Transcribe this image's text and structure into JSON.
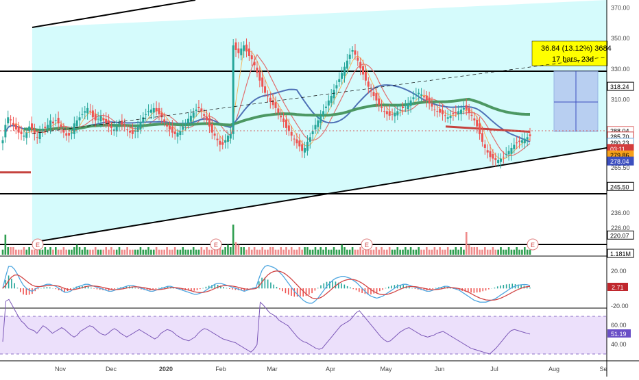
{
  "chart_data": {
    "type": "candlestick",
    "x_ticks": [
      "Nov",
      "Dec",
      "2020",
      "Feb",
      "Mar",
      "Apr",
      "May",
      "Jun",
      "Jul",
      "Aug",
      "Se"
    ],
    "price_axis": {
      "range": [
        218,
        372
      ],
      "tick_labels": [
        {
          "v": 370,
          "t": "370.00"
        },
        {
          "v": 350,
          "t": "350.00"
        },
        {
          "v": 330,
          "t": "330.00"
        },
        {
          "v": 310,
          "t": "310.00"
        },
        {
          "v": 265.5,
          "t": "265.50"
        },
        {
          "v": 236,
          "t": "236.00"
        },
        {
          "v": 226,
          "t": "226.00"
        }
      ]
    },
    "price_labels": [
      {
        "v": 318.24,
        "t": "318.24",
        "fill": "#ffffff",
        "stroke": "#000000",
        "color": "#000000"
      },
      {
        "v": 289.3,
        "t": "288.04",
        "fill": "#ffffff",
        "stroke": "#e07070",
        "color": "#000000"
      },
      {
        "v": 285.7,
        "t": "285.70",
        "fill": "#ffffff",
        "stroke": "#cc3333",
        "color": "#000000"
      },
      {
        "v": 281.6,
        "t": "280.23",
        "fill": "#ffffff",
        "stroke": "#6fa8dc",
        "color": "#000000"
      },
      {
        "v": 277.6,
        "t": "03:11",
        "fill": "#d33d3d",
        "stroke": "#d33d3d",
        "color": "#ffffff"
      },
      {
        "v": 273.4,
        "t": "279.86",
        "fill": "#f7a11a",
        "stroke": "#f7a11a",
        "color": "#000000"
      },
      {
        "v": 269.4,
        "t": "278.04",
        "fill": "#3d4fbf",
        "stroke": "#3d4fbf",
        "color": "#ffffff"
      },
      {
        "v": 252.8,
        "t": "245.50",
        "fill": "#ffffff",
        "stroke": "#000000",
        "color": "#000000"
      },
      {
        "v": 221.0,
        "t": "220.07",
        "fill": "#ffffff",
        "stroke": "#000000",
        "color": "#000000"
      }
    ],
    "volume_label": "1.181M",
    "hlines": [
      318.24,
      245.5,
      220.07
    ],
    "measure_label": {
      "line1": "36.84 (13.12%) 3684",
      "line2": "17 bars, 23d"
    },
    "earnings_marker": "E",
    "price_series_close": [
      283,
      293,
      298,
      296,
      293,
      290,
      288,
      287,
      286,
      288,
      292,
      290,
      287,
      285,
      288,
      290,
      291,
      293,
      296,
      294,
      296,
      294,
      292,
      288,
      286,
      286,
      288,
      294,
      296,
      298,
      300,
      302,
      304,
      302,
      298,
      296,
      297,
      299,
      296,
      294,
      292,
      291,
      290,
      292,
      294,
      293,
      292,
      290,
      288,
      287,
      289,
      292,
      295,
      298,
      300,
      302,
      303,
      304,
      302,
      300,
      298,
      295,
      292,
      290,
      288,
      287,
      288,
      289,
      292,
      294,
      297,
      299,
      301,
      303,
      304,
      302,
      299,
      296,
      292,
      288,
      286,
      283,
      280,
      280,
      283,
      286,
      287,
      345,
      342,
      340,
      343,
      345,
      341,
      338,
      336,
      332,
      327,
      322,
      318,
      314,
      312,
      308,
      306,
      304,
      301,
      298,
      295,
      291,
      289,
      286,
      284,
      281,
      279,
      276,
      278,
      282,
      285,
      289,
      293,
      296,
      299,
      302,
      305,
      309,
      312,
      316,
      319,
      323,
      327,
      331,
      335,
      339,
      342,
      339,
      335,
      330,
      326,
      322,
      318,
      315,
      312,
      309,
      306,
      304,
      302,
      300,
      299,
      300,
      301,
      302,
      303,
      304,
      305,
      307,
      309,
      311,
      313,
      314,
      313,
      311,
      309,
      307,
      305,
      303,
      302,
      301,
      300,
      299,
      298,
      299,
      300,
      301,
      302,
      303,
      304,
      303,
      301,
      299,
      296,
      292,
      287,
      282,
      278,
      275,
      272,
      271,
      270,
      270,
      271,
      272,
      274,
      276,
      278,
      280,
      281,
      282,
      283,
      284,
      285,
      285.7
    ],
    "volume_series": [
      2,
      8,
      3,
      3,
      3,
      2,
      2,
      2,
      3,
      2,
      3,
      2,
      2,
      3,
      2,
      2,
      3,
      2,
      3,
      2,
      3,
      2,
      2,
      3,
      2,
      2,
      2,
      3,
      4,
      3,
      2,
      3,
      2,
      2,
      2,
      3,
      2,
      2,
      2,
      3,
      2,
      3,
      2,
      2,
      3,
      2,
      2,
      3,
      2,
      2,
      2,
      2,
      3,
      2,
      2,
      3,
      2,
      2,
      3,
      2,
      2,
      2,
      3,
      2,
      2,
      3,
      2,
      2,
      3,
      2,
      2,
      2,
      3,
      2,
      2,
      3,
      2,
      3,
      2,
      2,
      2,
      3,
      3,
      2,
      3,
      4,
      3,
      12,
      5,
      4,
      3,
      3,
      2,
      3,
      2,
      3,
      2,
      2,
      3,
      2,
      2,
      3,
      3,
      2,
      2,
      3,
      2,
      3,
      2,
      3,
      2,
      2,
      3,
      2,
      3,
      3,
      2,
      2,
      3,
      2,
      3,
      2,
      3,
      2,
      2,
      3,
      2,
      2,
      4,
      3,
      2,
      2,
      3,
      2,
      2,
      3,
      2,
      2,
      3,
      2,
      2,
      3,
      2,
      3,
      2,
      2,
      3,
      2,
      2,
      3,
      2,
      2,
      3,
      2,
      3,
      2,
      2,
      3,
      2,
      2,
      3,
      2,
      2,
      3,
      2,
      3,
      2,
      2,
      3,
      2,
      2,
      3,
      2,
      3,
      2,
      9,
      4,
      3,
      3,
      3,
      2,
      2,
      3,
      2,
      2,
      3,
      2,
      2,
      3,
      2,
      2,
      3,
      2,
      2,
      3,
      2,
      2,
      3,
      2,
      2
    ],
    "macd_series": [
      0,
      12,
      22,
      22,
      19,
      14,
      8,
      3,
      0,
      -2,
      -3,
      -1,
      1,
      2,
      3,
      4,
      4,
      3,
      2,
      0,
      -2,
      -4,
      -4,
      -3,
      -1,
      1,
      2,
      3,
      4,
      4,
      3,
      2,
      1,
      0,
      -1,
      -2,
      -3,
      -3,
      -2,
      -1,
      0,
      1,
      2,
      3,
      3,
      2,
      1,
      0,
      -1,
      -2,
      -3,
      -3,
      -2,
      -1,
      0,
      1,
      2,
      2,
      1,
      0,
      -1,
      -2,
      -3,
      -4,
      -5,
      -6,
      -6,
      -5,
      -4,
      -2,
      0,
      2,
      4,
      5,
      5,
      4,
      3,
      2,
      1,
      0,
      -1,
      -2,
      -3,
      -2,
      -1,
      0,
      1,
      10,
      18,
      22,
      23,
      22,
      21,
      19,
      16,
      13,
      9,
      5,
      1,
      -3,
      -6,
      -9,
      -12,
      -14,
      -15,
      -15,
      -13,
      -10,
      -6,
      -2,
      2,
      5,
      8,
      10,
      11,
      12,
      12,
      11,
      10,
      8,
      6,
      3,
      0,
      -3,
      -6,
      -8,
      -9,
      -10,
      -9,
      -8,
      -6,
      -4,
      -2,
      0,
      2,
      3,
      4,
      4,
      3,
      2,
      1,
      0,
      -1,
      -2,
      -3,
      -3,
      -2,
      -1,
      0,
      1,
      2,
      2,
      1,
      0,
      -1,
      -2,
      -4,
      -6,
      -8,
      -10,
      -12,
      -13,
      -14,
      -14,
      -14,
      -13,
      -12,
      -11,
      -9,
      -7,
      -5,
      -3,
      -1,
      1,
      2,
      3,
      3.5,
      3.8,
      3.6,
      2.71
    ],
    "macd_axis": {
      "tick_labels": [
        "20.00",
        "-20.00"
      ],
      "value_label": "2.71"
    },
    "rsi_series": [
      43,
      86,
      88,
      82,
      76,
      70,
      65,
      62,
      58,
      56,
      55,
      52,
      56,
      60,
      58,
      55,
      52,
      54,
      56,
      58,
      56,
      53,
      50,
      48,
      50,
      54,
      56,
      58,
      60,
      59,
      56,
      53,
      51,
      50,
      52,
      55,
      57,
      55,
      52,
      50,
      48,
      50,
      52,
      54,
      56,
      54,
      52,
      50,
      48,
      46,
      48,
      52,
      54,
      56,
      55,
      53,
      50,
      48,
      46,
      45,
      44,
      46,
      48,
      52,
      55,
      57,
      56,
      54,
      52,
      50,
      48,
      46,
      45,
      44,
      43,
      42,
      40,
      38,
      36,
      34,
      32,
      35,
      40,
      85,
      82,
      78,
      74,
      72,
      70,
      66,
      64,
      62,
      60,
      56,
      52,
      48,
      45,
      43,
      42,
      40,
      38,
      36,
      35,
      36,
      40,
      44,
      48,
      52,
      56,
      60,
      62,
      64,
      66,
      70,
      74,
      76,
      72,
      68,
      64,
      60,
      56,
      52,
      48,
      45,
      43,
      44,
      47,
      50,
      53,
      55,
      57,
      58,
      56,
      54,
      52,
      50,
      49,
      48,
      49,
      50,
      52,
      53,
      54,
      52,
      50,
      48,
      46,
      44,
      42,
      40,
      38,
      36,
      35,
      34,
      33,
      32,
      31,
      30,
      33,
      36,
      40,
      44,
      48,
      52,
      55,
      56,
      55,
      54,
      53,
      52,
      51.19
    ],
    "rsi_axis": {
      "tick_labels": [
        "60.00",
        "40.00"
      ],
      "value_label": "51.19"
    }
  }
}
